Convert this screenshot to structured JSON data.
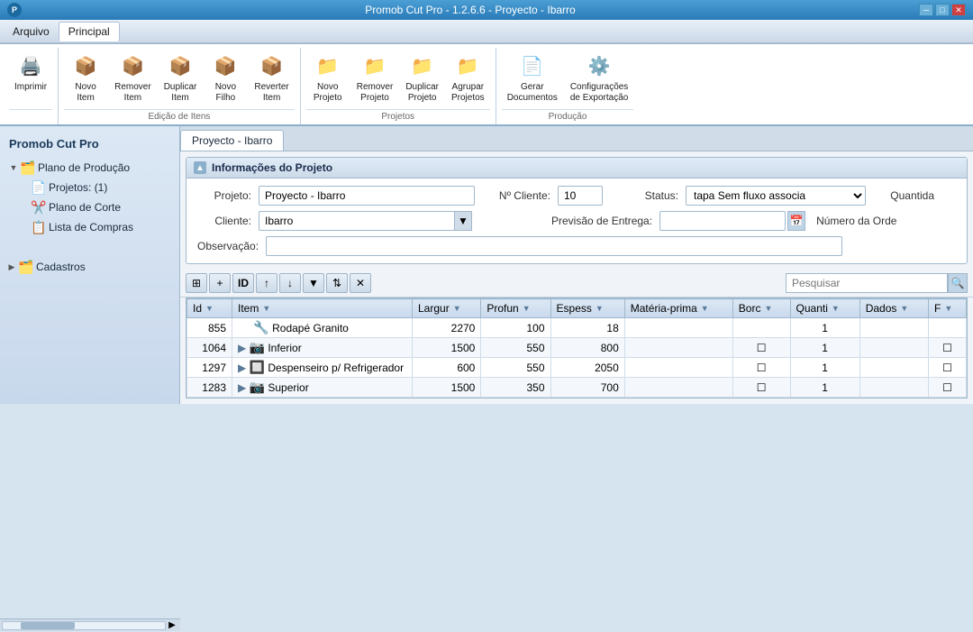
{
  "window": {
    "title": "Promob Cut Pro - 1.2.6.6 - Proyecto - Ibarro",
    "icon": "P"
  },
  "menu": {
    "items": [
      "Arquivo",
      "Principal"
    ]
  },
  "ribbon": {
    "active_tab": "Principal",
    "sections": [
      {
        "name": "",
        "buttons": [
          {
            "id": "imprimir",
            "label": "Imprimir",
            "icon": "🖨️"
          }
        ]
      },
      {
        "name": "Edição de Itens",
        "buttons": [
          {
            "id": "novo-item",
            "label": "Novo\nItem",
            "icon": "📦"
          },
          {
            "id": "remover-item",
            "label": "Remover\nItem",
            "icon": "📦"
          },
          {
            "id": "duplicar-item",
            "label": "Duplicar\nItem",
            "icon": "📦"
          },
          {
            "id": "novo-filho",
            "label": "Novo\nFilho",
            "icon": "📦"
          },
          {
            "id": "reverter-item",
            "label": "Reverter\nItem",
            "icon": "📦"
          }
        ]
      },
      {
        "name": "Projetos",
        "buttons": [
          {
            "id": "novo-projeto",
            "label": "Novo\nProjeto",
            "icon": "📁"
          },
          {
            "id": "remover-projeto",
            "label": "Remover\nProjeto",
            "icon": "📁"
          },
          {
            "id": "duplicar-projeto",
            "label": "Duplicar\nProjeto",
            "icon": "📁"
          },
          {
            "id": "agrupar-projetos",
            "label": "Agrupar\nProjetos",
            "icon": "📁"
          }
        ]
      },
      {
        "name": "Produção",
        "buttons": [
          {
            "id": "gerar-doc",
            "label": "Gerar\nDocumentos",
            "icon": "📄"
          },
          {
            "id": "config-export",
            "label": "Configurações\nde Exportação",
            "icon": "⚙️"
          }
        ]
      }
    ]
  },
  "sidebar": {
    "title": "Promob Cut Pro",
    "tree": [
      {
        "id": "plano-producao",
        "label": "Plano de Produção",
        "icon": "folder",
        "expand": true
      },
      {
        "id": "projetos",
        "label": "Projetos: (1)",
        "icon": "doc",
        "indent": 1
      },
      {
        "id": "plano-corte",
        "label": "Plano de Corte",
        "icon": "cut",
        "indent": 1
      },
      {
        "id": "lista-compras",
        "label": "Lista de Compras",
        "icon": "list",
        "indent": 1
      }
    ],
    "cadastros_label": "Cadastros"
  },
  "content": {
    "tab_label": "Proyecto - Ibarro",
    "panel_title": "Informações do Projeto",
    "form": {
      "projeto_label": "Projeto:",
      "projeto_value": "Proyecto - Ibarro",
      "cliente_label": "Cliente:",
      "cliente_value": "Ibarro",
      "observacao_label": "Observação:",
      "observacao_value": "",
      "no_cliente_label": "Nº Cliente:",
      "no_cliente_value": "10",
      "status_label": "Status:",
      "status_value": "tapa Sem fluxo associa",
      "quantidade_label": "Quantida",
      "quantidade_value": "",
      "previsao_label": "Previsão de Entrega:",
      "previsao_value": "",
      "numero_ordens_label": "Número da Orde",
      "numero_ordens_value": ""
    },
    "toolbar": {
      "search_placeholder": "Pesquisar"
    },
    "table": {
      "columns": [
        "Id",
        "Item",
        "Largur",
        "Profun",
        "Espess",
        "Matéria-prima",
        "Borc",
        "Quanti",
        "Dados",
        "F"
      ],
      "rows": [
        {
          "id": "855",
          "item": "Rodapé Granito",
          "largur": "2270",
          "profun": "100",
          "espess": "18",
          "materia": "",
          "borc": "",
          "quanti": "1",
          "dados": "",
          "f": "",
          "icon": "🔧",
          "expandable": false
        },
        {
          "id": "1064",
          "item": "Inferior",
          "largur": "1500",
          "profun": "550",
          "espess": "800",
          "materia": "",
          "borc": "☐",
          "quanti": "1",
          "dados": "",
          "f": "☐",
          "icon": "📷",
          "expandable": true
        },
        {
          "id": "1297",
          "item": "Despenseiro p/ Refrigerador",
          "largur": "600",
          "profun": "550",
          "espess": "2050",
          "materia": "",
          "borc": "☐",
          "quanti": "1",
          "dados": "",
          "f": "☐",
          "icon": "🔲",
          "expandable": true
        },
        {
          "id": "1283",
          "item": "Superior",
          "largur": "1500",
          "profun": "350",
          "espess": "700",
          "materia": "",
          "borc": "☐",
          "quanti": "1",
          "dados": "",
          "f": "☐",
          "icon": "📷",
          "expandable": true
        }
      ]
    }
  }
}
